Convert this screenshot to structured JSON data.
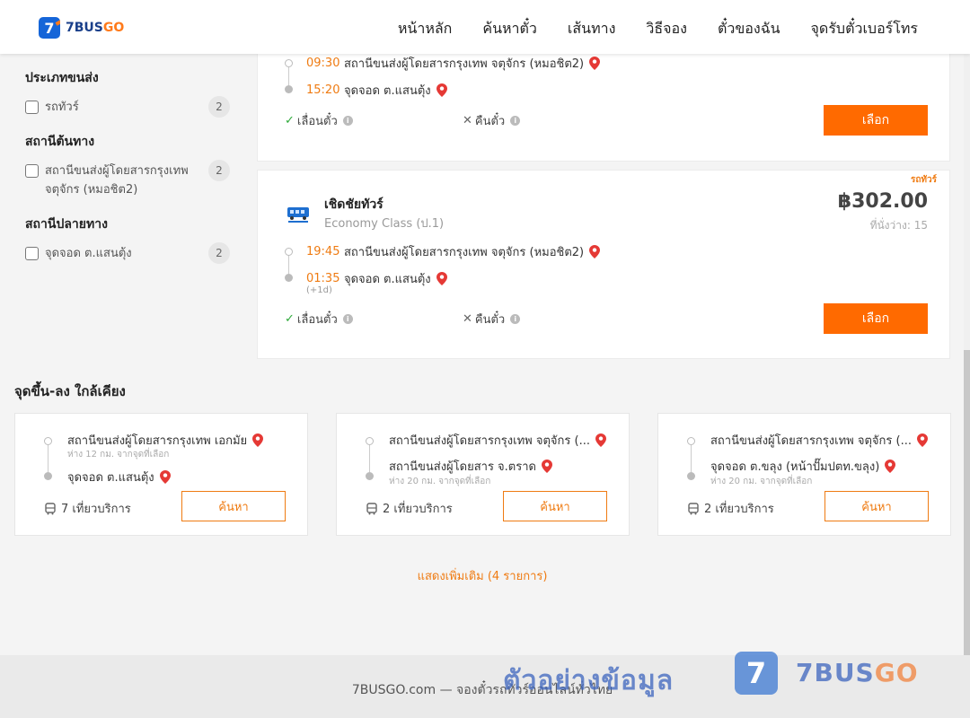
{
  "header": {
    "logo_digit": "7",
    "logo_text_a": "7BUS",
    "logo_text_b": "GO",
    "nav": [
      "หน้าหลัก",
      "ค้นหาตั๋ว",
      "เส้นทาง",
      "วิธีจอง",
      "ตั๋วของฉัน",
      "จุดรับตั๋วเบอร์โทร"
    ]
  },
  "sidebar": {
    "groups": [
      {
        "title": "ประเภทขนส่ง",
        "items": [
          {
            "label": "รถทัวร์",
            "count": "2"
          }
        ]
      },
      {
        "title": "สถานีต้นทาง",
        "items": [
          {
            "label": "สถานีขนส่งผู้โดยสารกรุงเทพ จตุจักร (หมอชิต2)",
            "count": "2"
          }
        ]
      },
      {
        "title": "สถานีปลายทาง",
        "items": [
          {
            "label": "จุดจอด ต.แสนตุ้ง",
            "count": "2"
          }
        ]
      }
    ]
  },
  "trips": [
    {
      "depart_time": "09:30",
      "depart_place": "สถานีขนส่งผู้โดยสารกรุงเทพ จตุจักร (หมอชิต2)",
      "arrive_time": "15:20",
      "arrive_place": "จุดจอด ต.แสนตุ้ง",
      "feature_reschedule": "เลื่อนตั๋ว",
      "feature_refund": "คืนตั๋ว",
      "select_label": "เลือก"
    },
    {
      "type_tag": "รถทัวร์",
      "operator": "เชิดชัยทัวร์",
      "class": "Economy Class (ป.1)",
      "price": "฿302.00",
      "seats": "ที่นั่งว่าง: 15",
      "depart_time": "19:45",
      "depart_place": "สถานีขนส่งผู้โดยสารกรุงเทพ จตุจักร (หมอชิต2)",
      "arrive_time": "01:35",
      "arrive_note": "(+1d)",
      "arrive_place": "จุดจอด ต.แสนตุ้ง",
      "feature_reschedule": "เลื่อนตั๋ว",
      "feature_refund": "คืนตั๋ว",
      "select_label": "เลือก"
    }
  ],
  "nearby": {
    "title": "จุดขึ้น-ลง ใกล้เคียง",
    "cards": [
      {
        "from": "สถานีขนส่งผู้โดยสารกรุงเทพ เอกมัย",
        "from_dist": "ห่าง 12 กม. จากจุดที่เลือก",
        "to": "จุดจอด ต.แสนตุ้ง",
        "to_dist": "",
        "trips": "7 เที่ยวบริการ",
        "button": "ค้นหา"
      },
      {
        "from": "สถานีขนส่งผู้โดยสารกรุงเทพ จตุจักร (...",
        "from_dist": "",
        "to": "สถานีขนส่งผู้โดยสาร จ.ตราด",
        "to_dist": "ห่าง 20 กม. จากจุดที่เลือก",
        "trips": "2 เที่ยวบริการ",
        "button": "ค้นหา"
      },
      {
        "from": "สถานีขนส่งผู้โดยสารกรุงเทพ จตุจักร (...",
        "from_dist": "",
        "to": "จุดจอด ต.ขลุง (หน้าปั๊มปตท.ขลุง)",
        "to_dist": "ห่าง 20 กม. จากจุดที่เลือก",
        "trips": "2 เที่ยวบริการ",
        "button": "ค้นหา"
      }
    ],
    "show_more": "แสดงเพิ่มเติม (4 รายการ)"
  },
  "footer": {
    "text": "7BUSGO.com — จองตั๋วรถทัวร์ออนไลน์ทั่วไทย"
  },
  "watermark": {
    "text": "ตัวอย่างข้อมูล",
    "digit": "7",
    "brand_a": "7BUS",
    "brand_b": "GO"
  },
  "colors": {
    "accent": "#ff6a00",
    "time": "#ef7b12",
    "logo_blue": "#1565d8",
    "pin_red": "#e53935",
    "check_green": "#2eaa3a"
  }
}
